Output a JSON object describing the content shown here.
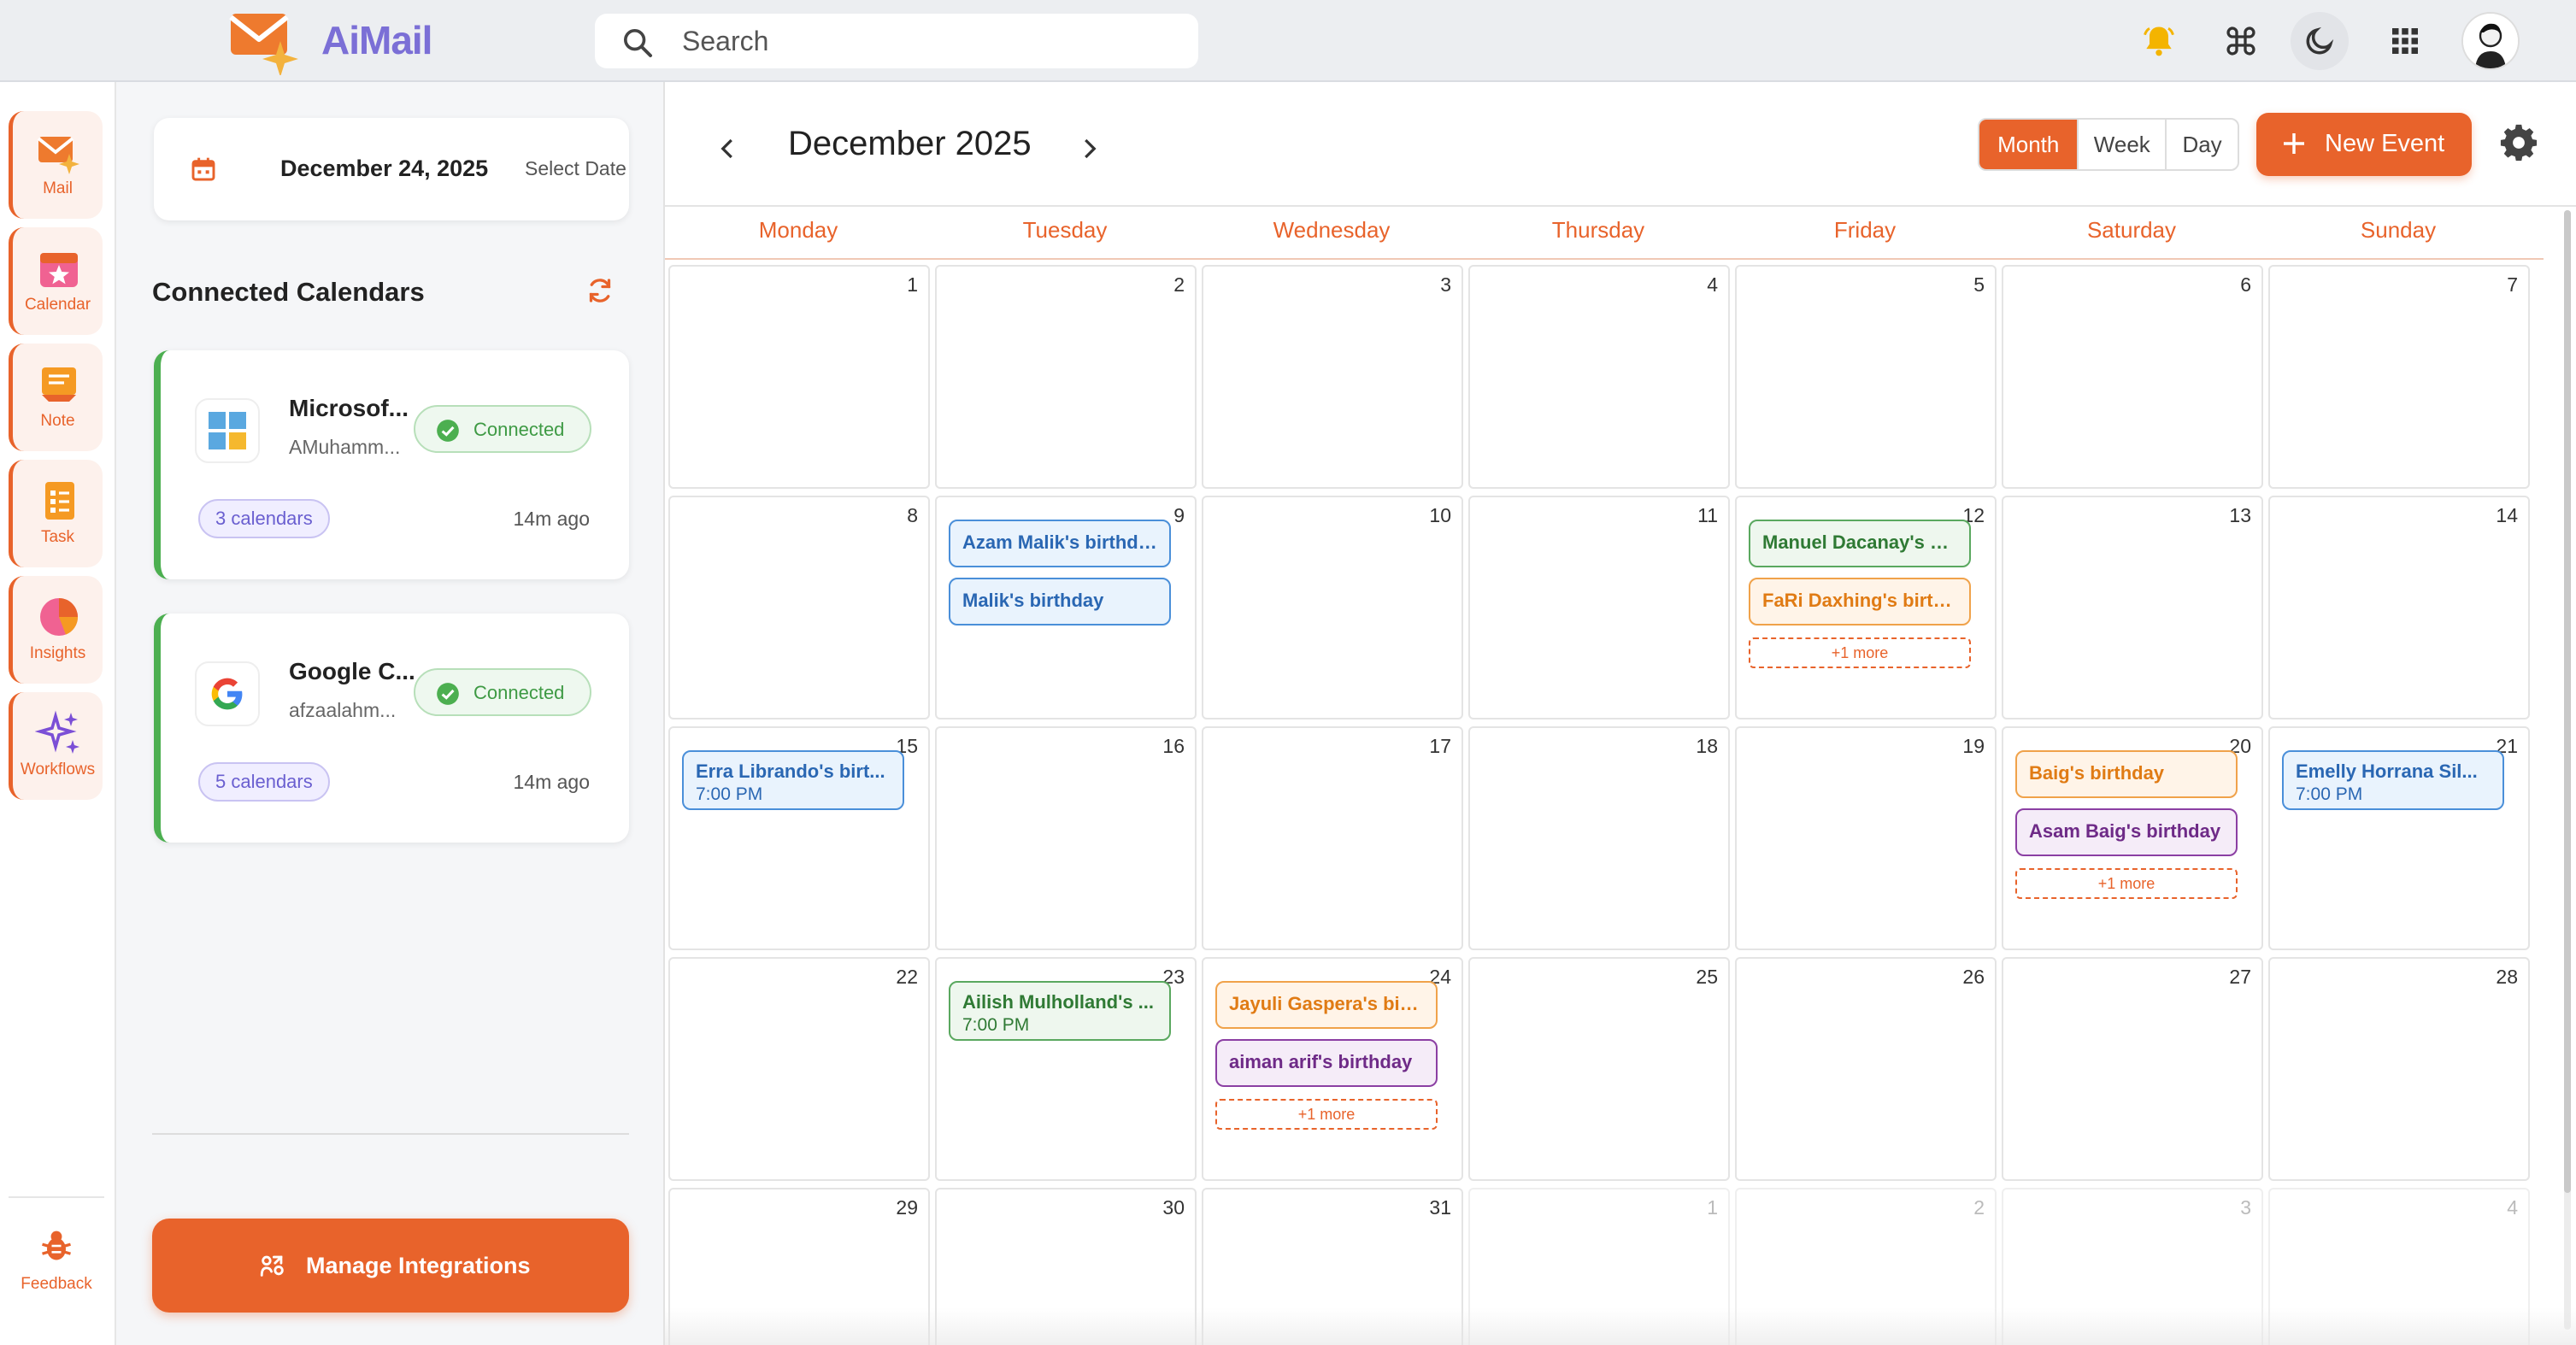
{
  "app": {
    "name": "AiMail"
  },
  "search": {
    "placeholder": "Search"
  },
  "rail": {
    "items": [
      {
        "label": "Mail",
        "icon": "mail-icon"
      },
      {
        "label": "Calendar",
        "icon": "calendar-icon"
      },
      {
        "label": "Note",
        "icon": "note-icon"
      },
      {
        "label": "Task",
        "icon": "task-icon"
      },
      {
        "label": "Insights",
        "icon": "pie-chart-icon"
      },
      {
        "label": "Workflows",
        "icon": "sparkles-icon"
      }
    ],
    "feedback": "Feedback"
  },
  "panel": {
    "date": "December 24, 2025",
    "select_date": "Select Date",
    "connected_title": "Connected Calendars",
    "accounts": [
      {
        "name": "Microsof...",
        "account": "AMuhamm...",
        "status": "Connected",
        "calendars": "3 calendars",
        "ago": "14m ago",
        "icon": "microsoft-logo-icon"
      },
      {
        "name": "Google C...",
        "account": "afzaalahm...",
        "status": "Connected",
        "calendars": "5 calendars",
        "ago": "14m ago",
        "icon": "google-logo-icon"
      }
    ],
    "manage": "Manage Integrations"
  },
  "calendar": {
    "title": "December 2025",
    "views": [
      "Month",
      "Week",
      "Day"
    ],
    "active_view": "Month",
    "new_event": "New Event",
    "weekdays": [
      "Monday",
      "Tuesday",
      "Wednesday",
      "Thursday",
      "Friday",
      "Saturday",
      "Sunday"
    ],
    "weeks": [
      [
        {
          "d": "1"
        },
        {
          "d": "2"
        },
        {
          "d": "3"
        },
        {
          "d": "4"
        },
        {
          "d": "5"
        },
        {
          "d": "6"
        },
        {
          "d": "7"
        }
      ],
      [
        {
          "d": "8"
        },
        {
          "d": "9",
          "events": [
            {
              "title": "Azam Malik's birthday",
              "color": "blue"
            },
            {
              "title": "Malik's birthday",
              "color": "blue"
            }
          ]
        },
        {
          "d": "10"
        },
        {
          "d": "11"
        },
        {
          "d": "12",
          "events": [
            {
              "title": "Manuel Dacanay's bi...",
              "color": "green"
            },
            {
              "title": "FaRi Daxhing's birth...",
              "color": "orange"
            }
          ],
          "more": "+1 more"
        },
        {
          "d": "13"
        },
        {
          "d": "14"
        }
      ],
      [
        {
          "d": "15",
          "events": [
            {
              "title": "Erra Librando's birt...",
              "time": "7:00 PM",
              "color": "blue"
            }
          ]
        },
        {
          "d": "16"
        },
        {
          "d": "17"
        },
        {
          "d": "18"
        },
        {
          "d": "19"
        },
        {
          "d": "20",
          "events": [
            {
              "title": "Baig's birthday",
              "color": "orange"
            },
            {
              "title": "Asam Baig's birthday",
              "color": "purple"
            }
          ],
          "more": "+1 more"
        },
        {
          "d": "21",
          "events": [
            {
              "title": "Emelly Horrana Sil...",
              "time": "7:00 PM",
              "color": "blue"
            }
          ]
        }
      ],
      [
        {
          "d": "22"
        },
        {
          "d": "23",
          "events": [
            {
              "title": "Ailish Mulholland's ...",
              "time": "7:00 PM",
              "color": "green"
            }
          ]
        },
        {
          "d": "24",
          "events": [
            {
              "title": "Jayuli Gaspera's birt...",
              "color": "orange"
            },
            {
              "title": "aiman arif's birthday",
              "color": "purple"
            }
          ],
          "more": "+1 more"
        },
        {
          "d": "25"
        },
        {
          "d": "26"
        },
        {
          "d": "27"
        },
        {
          "d": "28"
        }
      ],
      [
        {
          "d": "29"
        },
        {
          "d": "30"
        },
        {
          "d": "31"
        },
        {
          "d": "1",
          "other": true
        },
        {
          "d": "2",
          "other": true
        },
        {
          "d": "3",
          "other": true
        },
        {
          "d": "4",
          "other": true
        }
      ]
    ]
  },
  "colors": {
    "accent": "#e8632b",
    "brand": "#7b6fd6",
    "connected": "#4caf50"
  }
}
